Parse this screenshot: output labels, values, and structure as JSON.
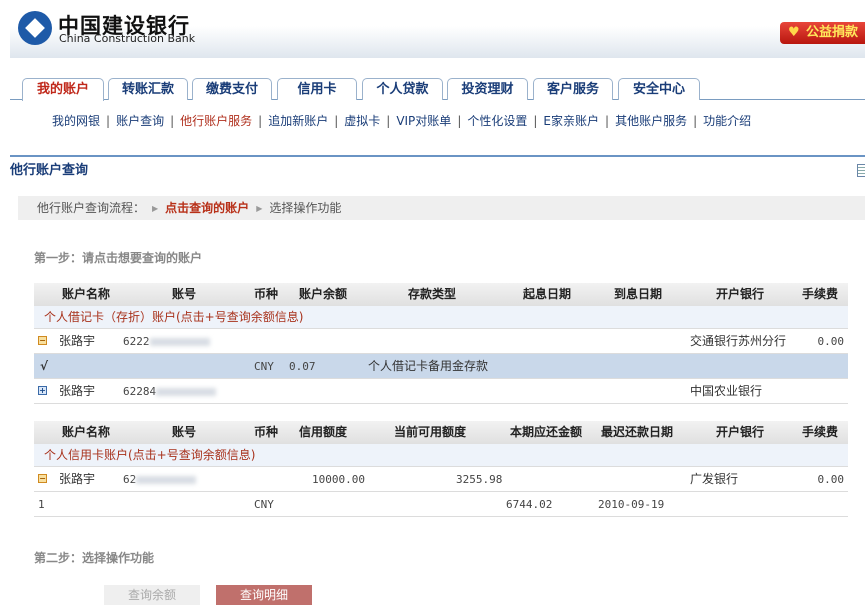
{
  "header": {
    "logo_cn": "中国建设银行",
    "logo_en": "China Construction Bank",
    "donate_label": "公益捐款"
  },
  "tabs": [
    "我的账户",
    "转账汇款",
    "缴费支付",
    "信用卡",
    "个人贷款",
    "投资理财",
    "客户服务",
    "安全中心"
  ],
  "subnav": [
    "我的网银",
    "账户查询",
    "他行账户服务",
    "追加新账户",
    "虚拟卡",
    "VIP对账单",
    "个性化设置",
    "E家亲账户",
    "其他账户服务",
    "功能介绍"
  ],
  "page_title": "他行账户查询",
  "breadcrumb": {
    "label": "他行账户查询流程：",
    "current": "点击查询的账户",
    "next": "选择操作功能"
  },
  "step1": "第一步：请点击想要查询的账户",
  "debit": {
    "headers": [
      "账户名称",
      "账号",
      "币种",
      "账户余额",
      "存款类型",
      "起息日期",
      "到息日期",
      "开户银行",
      "手续费"
    ],
    "group": "个人借记卡（存折）账户(点击+号查询余额信息)",
    "rows": [
      {
        "name": "张路宇",
        "account": "6222",
        "bank": "交通银行苏州分行",
        "fee": "0.00"
      },
      {
        "mark": "√",
        "currency": "CNY",
        "balance": "0.07",
        "type": "个人借记卡备用金存款"
      },
      {
        "name": "张路宇",
        "account": "62284",
        "bank": "中国农业银行"
      }
    ]
  },
  "credit": {
    "headers": [
      "账户名称",
      "账号",
      "币种",
      "信用额度",
      "当前可用额度",
      "本期应还金额",
      "最迟还款日期",
      "开户银行",
      "手续费"
    ],
    "group": "个人信用卡账户(点击+号查询余额信息)",
    "rows": [
      {
        "name": "张路宇",
        "account": "62",
        "limit": "10000.00",
        "available": "3255.98",
        "bank": "广发银行",
        "fee": "0.00"
      },
      {
        "index": "1",
        "currency": "CNY",
        "due": "6744.02",
        "due_date": "2010-09-19"
      }
    ]
  },
  "step2": "第二步：选择操作功能",
  "buttons": {
    "balance": "查询余额",
    "detail": "查询明细"
  }
}
